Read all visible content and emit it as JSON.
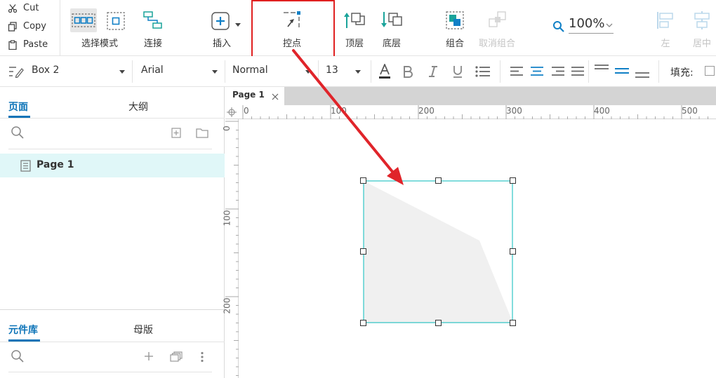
{
  "clipboard": {
    "cut": "Cut",
    "copy": "Copy",
    "paste": "Paste"
  },
  "toolbar": {
    "select_mode": "选择模式",
    "connect": "连接",
    "insert": "插入",
    "control_point": "控点",
    "to_front": "顶层",
    "to_back": "底层",
    "group": "组合",
    "ungroup": "取消组合",
    "zoom": "100%",
    "align_left": "左",
    "align_center": "居中"
  },
  "format": {
    "style": "Box 2",
    "font": "Arial",
    "weight": "Normal",
    "size": "13",
    "fill_label": "填充:"
  },
  "left_panel": {
    "pages_tab": "页面",
    "outline_tab": "大纲",
    "pages": [
      {
        "label": "Page 1"
      }
    ],
    "library_tab": "元件库",
    "masters_tab": "母版"
  },
  "canvas": {
    "tab_label": "Page 1",
    "ruler_h": [
      "0",
      "100",
      "200",
      "300",
      "400",
      "500"
    ],
    "ruler_v": [
      "0",
      "100",
      "200"
    ]
  },
  "colors": {
    "accent": "#0d74b8",
    "highlight_box": "#e02020",
    "arrow": "#e0242a",
    "selection": "#2ec6c6",
    "shape_fill": "#f0f0f0",
    "page_selected_bg": "#e0f7f8"
  },
  "icons": [
    "cut-icon",
    "copy-icon",
    "paste-icon",
    "select-intersect-icon",
    "select-contain-icon",
    "connector-icon",
    "insert-plus-icon",
    "control-point-icon",
    "bring-to-front-icon",
    "send-to-back-icon",
    "group-icon",
    "ungroup-icon",
    "zoom-search-icon",
    "align-left-icon",
    "align-center-icon",
    "style-icon",
    "font-color-icon",
    "bold-icon",
    "italic-icon",
    "underline-icon",
    "bullets-icon",
    "text-align-left-icon",
    "text-align-center-icon",
    "text-align-right-icon",
    "text-justify-icon",
    "valign-top-icon",
    "valign-middle-icon",
    "valign-bottom-icon",
    "search-icon",
    "add-folder-icon",
    "folder-icon",
    "page-icon",
    "add-icon",
    "library-icon",
    "more-icon",
    "close-icon"
  ]
}
